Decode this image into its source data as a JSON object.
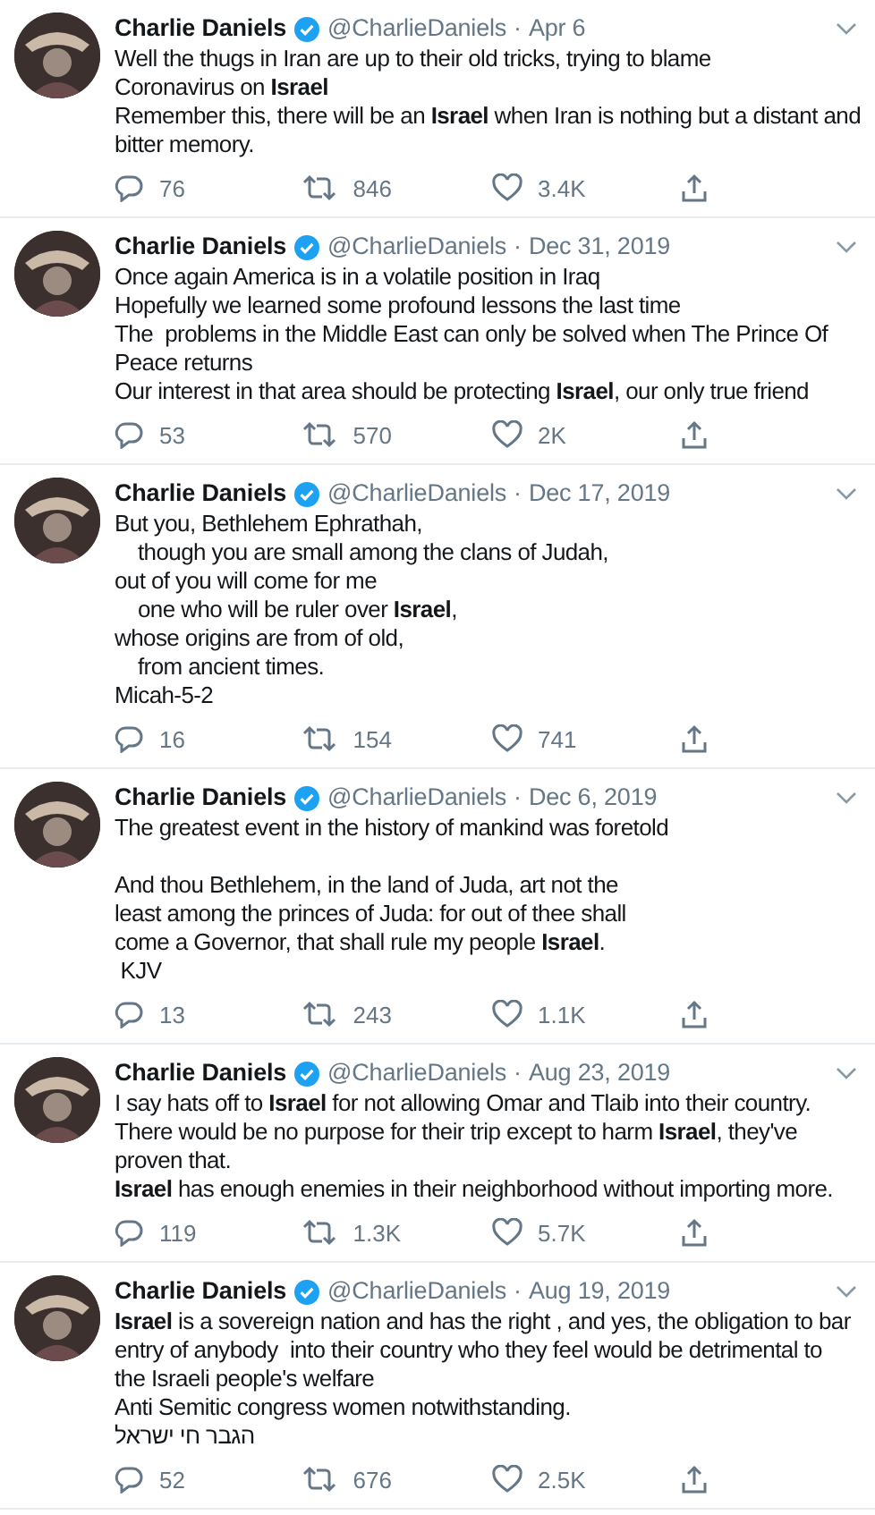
{
  "tweets": [
    {
      "name": "Charlie Daniels",
      "handle": "@CharlieDaniels",
      "separator": "·",
      "date": "Apr 6",
      "verified": true,
      "lines": [
        {
          "kind": "plain",
          "text": "Well the thugs in Iran are up to their old tricks, trying to blame"
        },
        {
          "kind": "plain",
          "text": "Coronavirus on **Israel**"
        },
        {
          "kind": "plain",
          "text": "Remember this, there will be an **Israel** when Iran is nothing but a distant and"
        },
        {
          "kind": "plain",
          "text": "bitter memory."
        }
      ],
      "replies": "76",
      "retweets": "846",
      "likes": "3.4K"
    },
    {
      "name": "Charlie Daniels",
      "handle": "@CharlieDaniels",
      "separator": "·",
      "date": "Dec 31, 2019",
      "verified": true,
      "lines": [
        {
          "kind": "plain",
          "text": "Once again America is in a volatile position in Iraq"
        },
        {
          "kind": "plain",
          "text": "Hopefully we learned some profound lessons the last time"
        },
        {
          "kind": "plain",
          "text": "The  problems in the Middle East can only be solved when The Prince Of"
        },
        {
          "kind": "plain",
          "text": "Peace returns"
        },
        {
          "kind": "plain",
          "text": "Our interest in that area should be protecting **Israel**, our only true friend"
        }
      ],
      "replies": "53",
      "retweets": "570",
      "likes": "2K"
    },
    {
      "name": "Charlie Daniels",
      "handle": "@CharlieDaniels",
      "separator": "·",
      "date": "Dec 17, 2019",
      "verified": true,
      "lines": [
        {
          "kind": "plain",
          "text": "But you, Bethlehem Ephrathah,"
        },
        {
          "kind": "indented",
          "text": "though you are small among the clans of Judah,"
        },
        {
          "kind": "plain",
          "text": "out of you will come for me"
        },
        {
          "kind": "indented",
          "text": "one who will be ruler over **Israel**,"
        },
        {
          "kind": "plain",
          "text": "whose origins are from of old,"
        },
        {
          "kind": "indented",
          "text": "from ancient times."
        },
        {
          "kind": "plain",
          "text": "Micah-5-2"
        }
      ],
      "replies": "16",
      "retweets": "154",
      "likes": "741"
    },
    {
      "name": "Charlie Daniels",
      "handle": "@CharlieDaniels",
      "separator": "·",
      "date": "Dec 6, 2019",
      "verified": true,
      "lines": [
        {
          "kind": "plain",
          "text": "The greatest event in the history of mankind was foretold"
        },
        {
          "kind": "spaced",
          "text": "And thou Bethlehem, in the land of Juda, art not the"
        },
        {
          "kind": "plain",
          "text": "least among the princes of Juda: for out of thee shall"
        },
        {
          "kind": "plain",
          "text": "come a Governor, that shall rule my people **Israel**."
        },
        {
          "kind": "plain",
          "text": " KJV"
        }
      ],
      "replies": "13",
      "retweets": "243",
      "likes": "1.1K"
    },
    {
      "name": "Charlie Daniels",
      "handle": "@CharlieDaniels",
      "separator": "·",
      "date": "Aug 23, 2019",
      "verified": true,
      "lines": [
        {
          "kind": "plain",
          "text": "I say hats off to **Israel** for not allowing Omar and Tlaib into their country."
        },
        {
          "kind": "plain",
          "text": "There would be no purpose for their trip except to harm **Israel**, they've"
        },
        {
          "kind": "plain",
          "text": "proven that."
        },
        {
          "kind": "plain",
          "text": "**Israel** has enough enemies in their neighborhood without importing more."
        }
      ],
      "replies": "119",
      "retweets": "1.3K",
      "likes": "5.7K"
    },
    {
      "name": "Charlie Daniels",
      "handle": "@CharlieDaniels",
      "separator": "·",
      "date": "Aug 19, 2019",
      "verified": true,
      "lines": [
        {
          "kind": "plain",
          "text": "**Israel** is a sovereign nation and has the right , and yes, the obligation to bar"
        },
        {
          "kind": "plain",
          "text": "entry of anybody  into their country who they feel would be detrimental to"
        },
        {
          "kind": "plain",
          "text": "the Israeli people's welfare"
        },
        {
          "kind": "plain",
          "text": "Anti Semitic congress women notwithstanding."
        },
        {
          "kind": "plain",
          "text": "הגבר חי ישראל"
        }
      ],
      "replies": "52",
      "retweets": "676",
      "likes": "2.5K"
    }
  ]
}
